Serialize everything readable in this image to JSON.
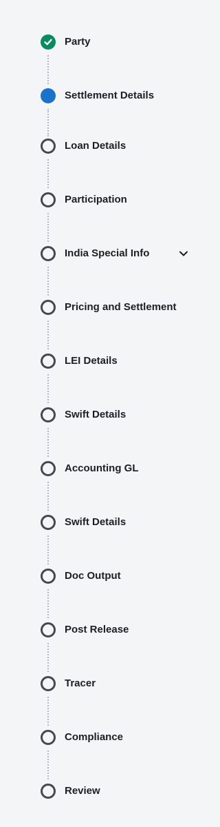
{
  "steps": [
    {
      "label": "Party",
      "status": "completed",
      "icon": "check-icon"
    },
    {
      "label": "Settlement Details",
      "status": "current",
      "icon": "dot-icon"
    },
    {
      "label": "Loan Details",
      "status": "pending",
      "icon": "circle-icon"
    },
    {
      "label": "Participation",
      "status": "pending",
      "icon": "circle-icon"
    },
    {
      "label": "India Special Info",
      "status": "pending",
      "icon": "circle-icon",
      "expandable": true,
      "expand_icon": "chevron-down-icon"
    },
    {
      "label": "Pricing and Settlement",
      "status": "pending",
      "icon": "circle-icon"
    },
    {
      "label": "LEI Details",
      "status": "pending",
      "icon": "circle-icon"
    },
    {
      "label": "Swift Details",
      "status": "pending",
      "icon": "circle-icon"
    },
    {
      "label": "Accounting GL",
      "status": "pending",
      "icon": "circle-icon"
    },
    {
      "label": "Swift Details",
      "status": "pending",
      "icon": "circle-icon"
    },
    {
      "label": "Doc Output",
      "status": "pending",
      "icon": "circle-icon"
    },
    {
      "label": "Post Release",
      "status": "pending",
      "icon": "circle-icon"
    },
    {
      "label": "Tracer",
      "status": "pending",
      "icon": "circle-icon"
    },
    {
      "label": "Compliance",
      "status": "pending",
      "icon": "circle-icon"
    },
    {
      "label": "Review",
      "status": "pending",
      "icon": "circle-icon"
    }
  ],
  "colors": {
    "completed": "#0a8a5f",
    "current": "#1b72c9",
    "pending_border": "#45484d",
    "connector": "#b4b8bf",
    "background": "#f4f5f7",
    "text": "#1c1e21"
  }
}
